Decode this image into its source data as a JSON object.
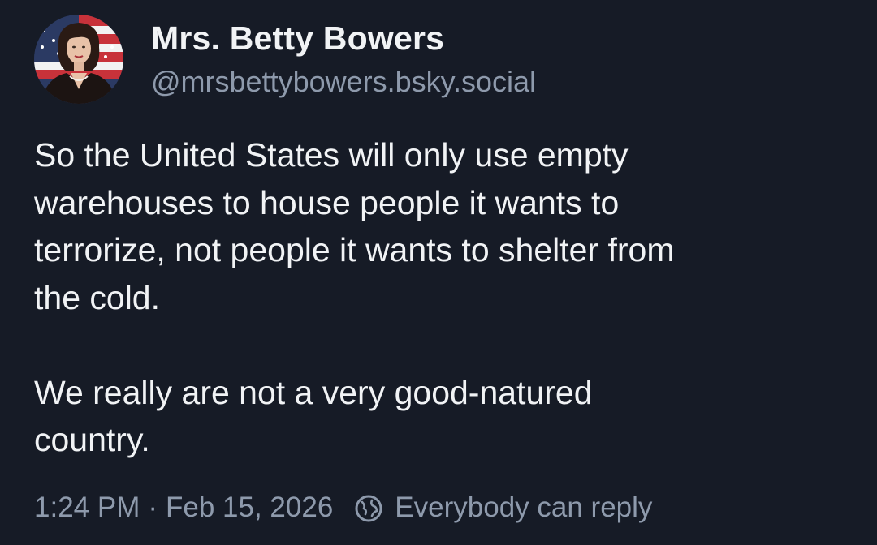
{
  "author": {
    "display_name": "Mrs. Betty Bowers",
    "handle": "@mrsbettybowers.bsky.social",
    "avatar_icon": "avatar-photo"
  },
  "post": {
    "text": "So the United States will only use empty\nwarehouses to house people it wants to\nterrorize, not people it wants to shelter from\nthe cold.\n\nWe really are not a very good-natured\ncountry."
  },
  "meta": {
    "time": "1:24 PM",
    "separator": "·",
    "date": "Feb 15, 2026",
    "reply_icon": "globe-icon",
    "reply_setting": "Everybody can reply"
  },
  "colors": {
    "background": "#161b26",
    "text_primary": "#f1f3f5",
    "text_secondary": "#8e9aac"
  }
}
